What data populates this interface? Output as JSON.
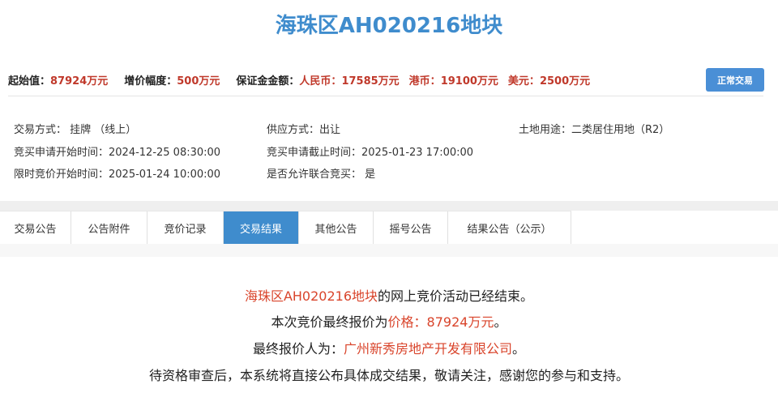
{
  "title": "海珠区AH020216地块",
  "prices": {
    "start_label": "起始值：",
    "start_value": "87924万元",
    "increment_label": "增价幅度：",
    "increment_value": "500万元",
    "deposit_label": "保证金金额：",
    "rmb_label": "人民币：",
    "rmb_value": "17585万元",
    "hkd_label": "港币：",
    "hkd_value": "19100万元",
    "usd_label": "美元：",
    "usd_value": "2500万元"
  },
  "status_button": "正常交易",
  "info": {
    "trade_method": "交易方式：  挂牌  （线上）",
    "supply_method": "供应方式：出让",
    "land_use": "土地用途：二类居住用地（R2）",
    "apply_start": "竞买申请开始时间：2024-12-25 08:30:00",
    "apply_end": "竞买申请截止时间：2025-01-23 17:00:00",
    "bid_start": "限时竞价开始时间：2025-01-24 10:00:00",
    "joint_bid": "是否允许联合竞买：  是"
  },
  "tabs": [
    "交易公告",
    "公告附件",
    "竞价记录",
    "交易结果",
    "其他公告",
    "摇号公告",
    "结果公告（公示）"
  ],
  "active_tab": "交易结果",
  "result": {
    "line1_red": "海珠区AH020216地块",
    "line1_rest": "的网上竞价活动已经结束。",
    "line2_pre": "本次竞价最终报价为",
    "line2_red": "价格：87924万元",
    "line2_post": "。",
    "line3_pre": "最终报价人为：",
    "line3_red": "广州新秀房地产开发有限公司",
    "line3_post": "。",
    "line4": "待资格审查后，本系统将直接公布具体成交结果，敬请关注，感谢您的参与和支持。"
  }
}
